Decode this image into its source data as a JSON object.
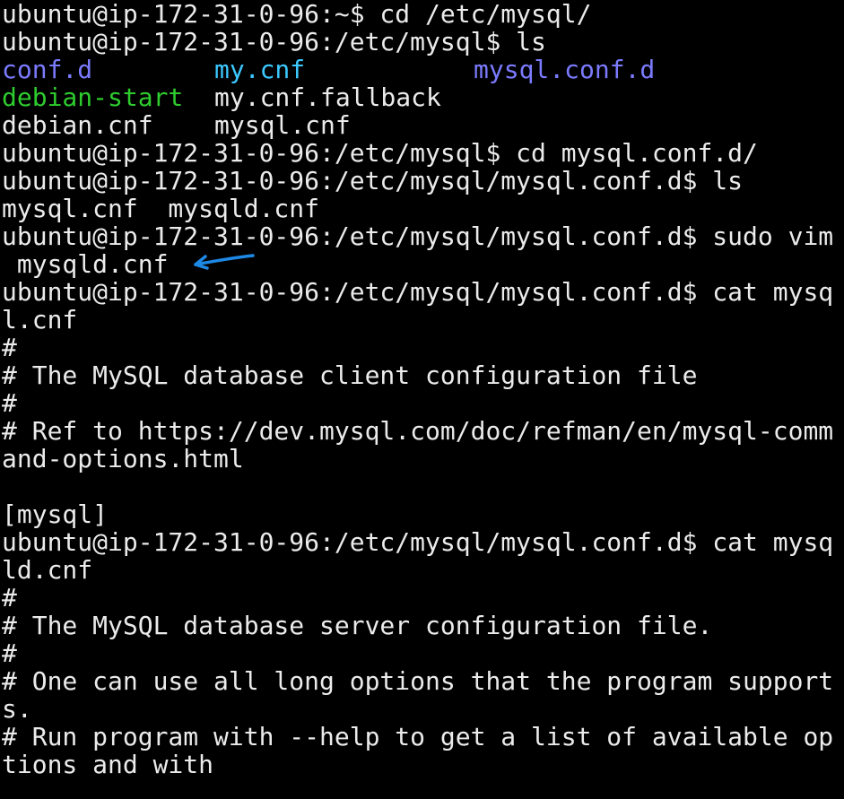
{
  "terminal": {
    "colors": {
      "background": "#000000",
      "foreground": "#ebebeb",
      "directory": "#7b7bff",
      "symlink": "#3cc8ff",
      "executable": "#2ecc2e",
      "annotation_arrow": "#1e88e5"
    },
    "lines": [
      "ubuntu@ip-172-31-0-96:~$ cd /etc/mysql/",
      "ubuntu@ip-172-31-0-96:/etc/mysql$ ls",
      "",
      "",
      "",
      "ubuntu@ip-172-31-0-96:/etc/mysql$ cd mysql.conf.d/",
      "ubuntu@ip-172-31-0-96:/etc/mysql/mysql.conf.d$ ls",
      "mysql.cnf  mysqld.cnf",
      "ubuntu@ip-172-31-0-96:/etc/mysql/mysql.conf.d$ sudo vim",
      " mysqld.cnf",
      "ubuntu@ip-172-31-0-96:/etc/mysql/mysql.conf.d$ cat mysq",
      "l.cnf",
      "#",
      "# The MySQL database client configuration file",
      "#",
      "# Ref to https://dev.mysql.com/doc/refman/en/mysql-comm",
      "and-options.html",
      "",
      "[mysql]",
      "ubuntu@ip-172-31-0-96:/etc/mysql/mysql.conf.d$ cat mysq",
      "ld.cnf",
      "#",
      "# The MySQL database server configuration file.",
      "#",
      "# One can use all long options that the program support",
      "s.",
      "# Run program with --help to get a list of available op",
      "tions and with"
    ],
    "ls_listing": {
      "row1": {
        "col1": "conf.d",
        "col2": "my.cnf",
        "col3": "mysql.conf.d"
      },
      "row2": {
        "col1": "debian-start",
        "col2": "my.cnf.fallback"
      },
      "row3": {
        "col1": "debian.cnf",
        "col2": "mysql.cnf"
      }
    }
  }
}
